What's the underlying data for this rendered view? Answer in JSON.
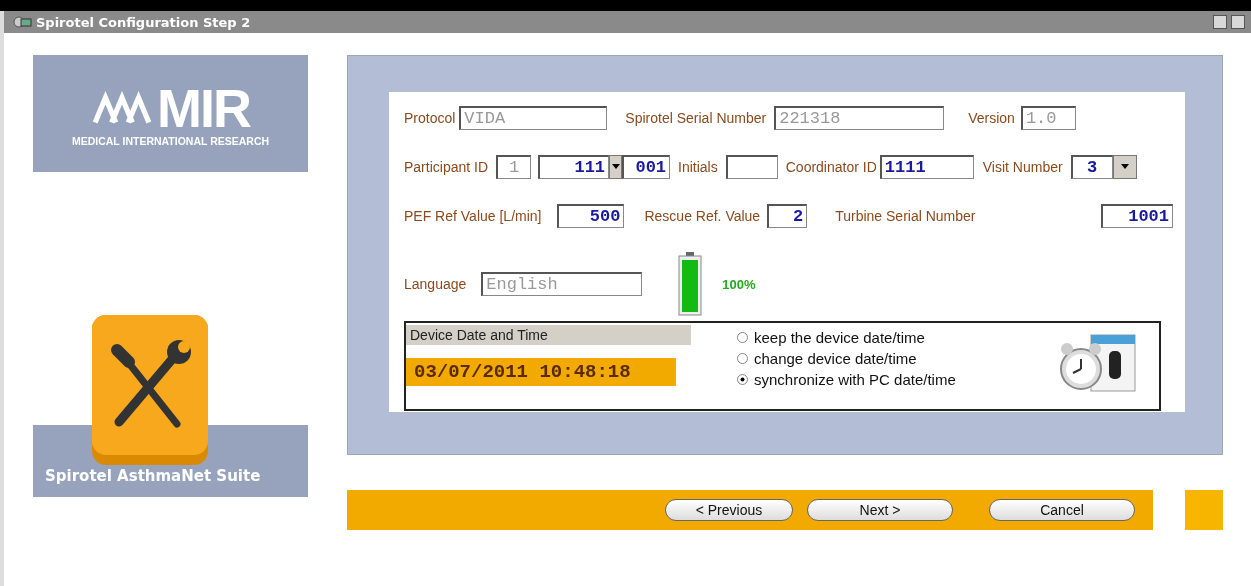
{
  "window": {
    "title": "Spirotel Configuration Step 2"
  },
  "logo": {
    "mark": "MIR",
    "tagline": "MEDICAL INTERNATIONAL RESEARCH"
  },
  "suite_label": "Spirotel AsthmaNet Suite",
  "form": {
    "row_1": [
      {
        "label": "Protocol",
        "value": "VIDA",
        "disabled": true
      },
      {
        "label": "Spirotel Serial Number",
        "value": "221318",
        "disabled": true
      },
      {
        "label": "Version",
        "value": "1.0",
        "disabled": true
      }
    ],
    "participant_id": {
      "label": "Participant ID",
      "parts": [
        {
          "value": "1",
          "disabled": true
        },
        {
          "value": "111",
          "disabled": false
        },
        {
          "value": "001",
          "disabled": false
        }
      ]
    },
    "initials": {
      "label": "Initials"
    },
    "coordinator_id": {
      "label": "Coordinator ID",
      "value": "1111"
    },
    "visit_number": {
      "label": "Visit Number",
      "value": "3"
    },
    "row_3": [
      {
        "label": "PEF Ref Value  [L/min]",
        "value": "500"
      },
      {
        "label": "Rescue Ref. Value",
        "value": "2"
      },
      {
        "label": "Turbine Serial Number",
        "value": "1001"
      }
    ],
    "language": {
      "label": "Language",
      "value": "English",
      "disabled": true
    },
    "battery": {
      "level": 1,
      "reading": "100%"
    },
    "date_time": {
      "title": "Device Date and Time",
      "value": "03/07/2011 10:48:18",
      "options": [
        {
          "label": "keep the device date/time",
          "selected": false
        },
        {
          "label": "change device date/time",
          "selected": false
        },
        {
          "label": "synchronize with PC date/time",
          "selected": true
        }
      ]
    }
  },
  "buttons": [
    "< Previous",
    "Next >",
    "Cancel"
  ]
}
